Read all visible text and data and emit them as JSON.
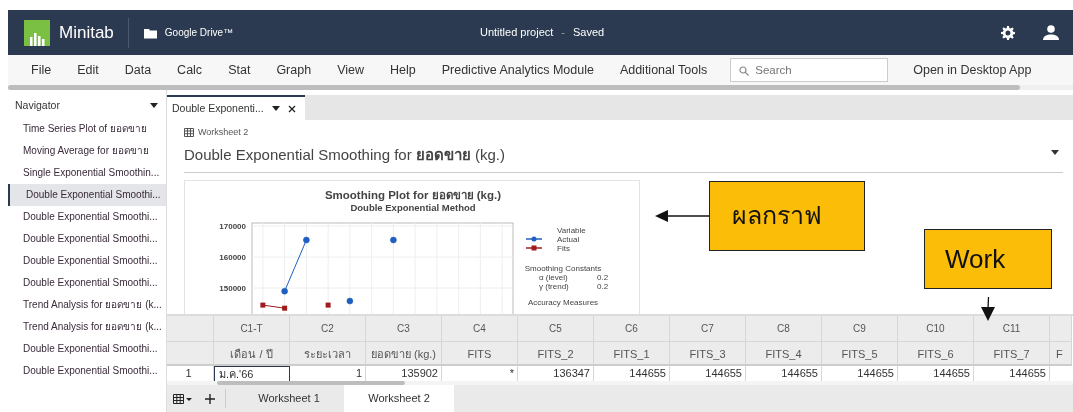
{
  "app": {
    "name": "Minitab",
    "storage": "Google Drive™",
    "project": "Untitled project",
    "separator": "-",
    "save_status": "Saved"
  },
  "menu": [
    "File",
    "Edit",
    "Data",
    "Calc",
    "Stat",
    "Graph",
    "View",
    "Help",
    "Predictive Analytics Module",
    "Additional Tools"
  ],
  "search": {
    "placeholder": "Search"
  },
  "open_desktop": "Open in Desktop App",
  "navigator": {
    "title": "Navigator",
    "items": [
      {
        "label": "Time Series Plot of ยอดขาย",
        "selected": false
      },
      {
        "label": "Moving Average for ยอดขาย",
        "selected": false
      },
      {
        "label": "Single Exponential Smoothin...",
        "selected": false
      },
      {
        "label": "Double Exponential Smoothi...",
        "selected": true
      },
      {
        "label": "Double Exponential Smoothi...",
        "selected": false
      },
      {
        "label": "Double Exponential Smoothi...",
        "selected": false
      },
      {
        "label": "Double Exponential Smoothi...",
        "selected": false
      },
      {
        "label": "Double Exponential Smoothi...",
        "selected": false
      },
      {
        "label": "Trend Analysis for ยอดขาย (k...",
        "selected": false
      },
      {
        "label": "Trend Analysis for ยอดขาย (k...",
        "selected": false
      },
      {
        "label": "Double Exponential Smoothi...",
        "selected": false
      },
      {
        "label": "Double Exponential Smoothi...",
        "selected": false
      }
    ]
  },
  "document_tab": {
    "label": "Double Exponenti..."
  },
  "output": {
    "worksheet": "Worksheet 2",
    "title": "Double Exponential Smoothing for **ยอดขาย** (kg.)"
  },
  "chart": {
    "legend_title": "Variable",
    "constants_title": "Smoothing Constants",
    "constants": [
      {
        "label": "α (level)",
        "value": "0.2"
      },
      {
        "label": "γ (trend)",
        "value": "0.2"
      }
    ],
    "accuracy_title": "Accuracy Measures",
    "chart_data": {
      "type": "line",
      "title": "Smoothing Plot for ยอดขาย (kg.)",
      "subtitle": "Double Exponential Method",
      "ylim": [
        120000,
        171000
      ],
      "yticks": [
        150000,
        160000,
        170000
      ],
      "grid": true,
      "legend": true,
      "series": [
        {
          "name": "Actual",
          "color": "#1f5fbf",
          "marker": "circle",
          "values": [
            null,
            149000,
            165500,
            null,
            145800,
            null,
            165500,
            null,
            null,
            null,
            null,
            null
          ]
        },
        {
          "name": "Fits",
          "color": "#a01c1c",
          "marker": "square",
          "values": [
            144500,
            143500,
            null,
            144500,
            null,
            null,
            null,
            null,
            null,
            null,
            null,
            null
          ]
        }
      ]
    }
  },
  "callouts": [
    {
      "text": "ผลกราฟ",
      "kind": "left"
    },
    {
      "text": "Work",
      "kind": "down"
    }
  ],
  "grid": {
    "columns": [
      {
        "id": "C1-T",
        "name": "เดือน / ปี"
      },
      {
        "id": "C2",
        "name": "ระยะเวลา"
      },
      {
        "id": "C3",
        "name": "ยอดขาย (kg.)"
      },
      {
        "id": "C4",
        "name": "FITS"
      },
      {
        "id": "C5",
        "name": "FITS_2"
      },
      {
        "id": "C6",
        "name": "FITS_1"
      },
      {
        "id": "C7",
        "name": "FITS_3"
      },
      {
        "id": "C8",
        "name": "FITS_4"
      },
      {
        "id": "C9",
        "name": "FITS_5"
      },
      {
        "id": "C10",
        "name": "FITS_6"
      },
      {
        "id": "C11",
        "name": "FITS_7"
      },
      {
        "name": "F"
      }
    ],
    "rows": [
      {
        "number": "1",
        "cells": [
          "ม.ค.'66",
          "1",
          "135902",
          "*",
          "136347",
          "144655",
          "144655",
          "144655",
          "144655",
          "144655",
          "144655"
        ]
      }
    ]
  },
  "sheets": [
    {
      "label": "Worksheet 1",
      "selected": false
    },
    {
      "label": "Worksheet 2",
      "selected": true
    }
  ]
}
